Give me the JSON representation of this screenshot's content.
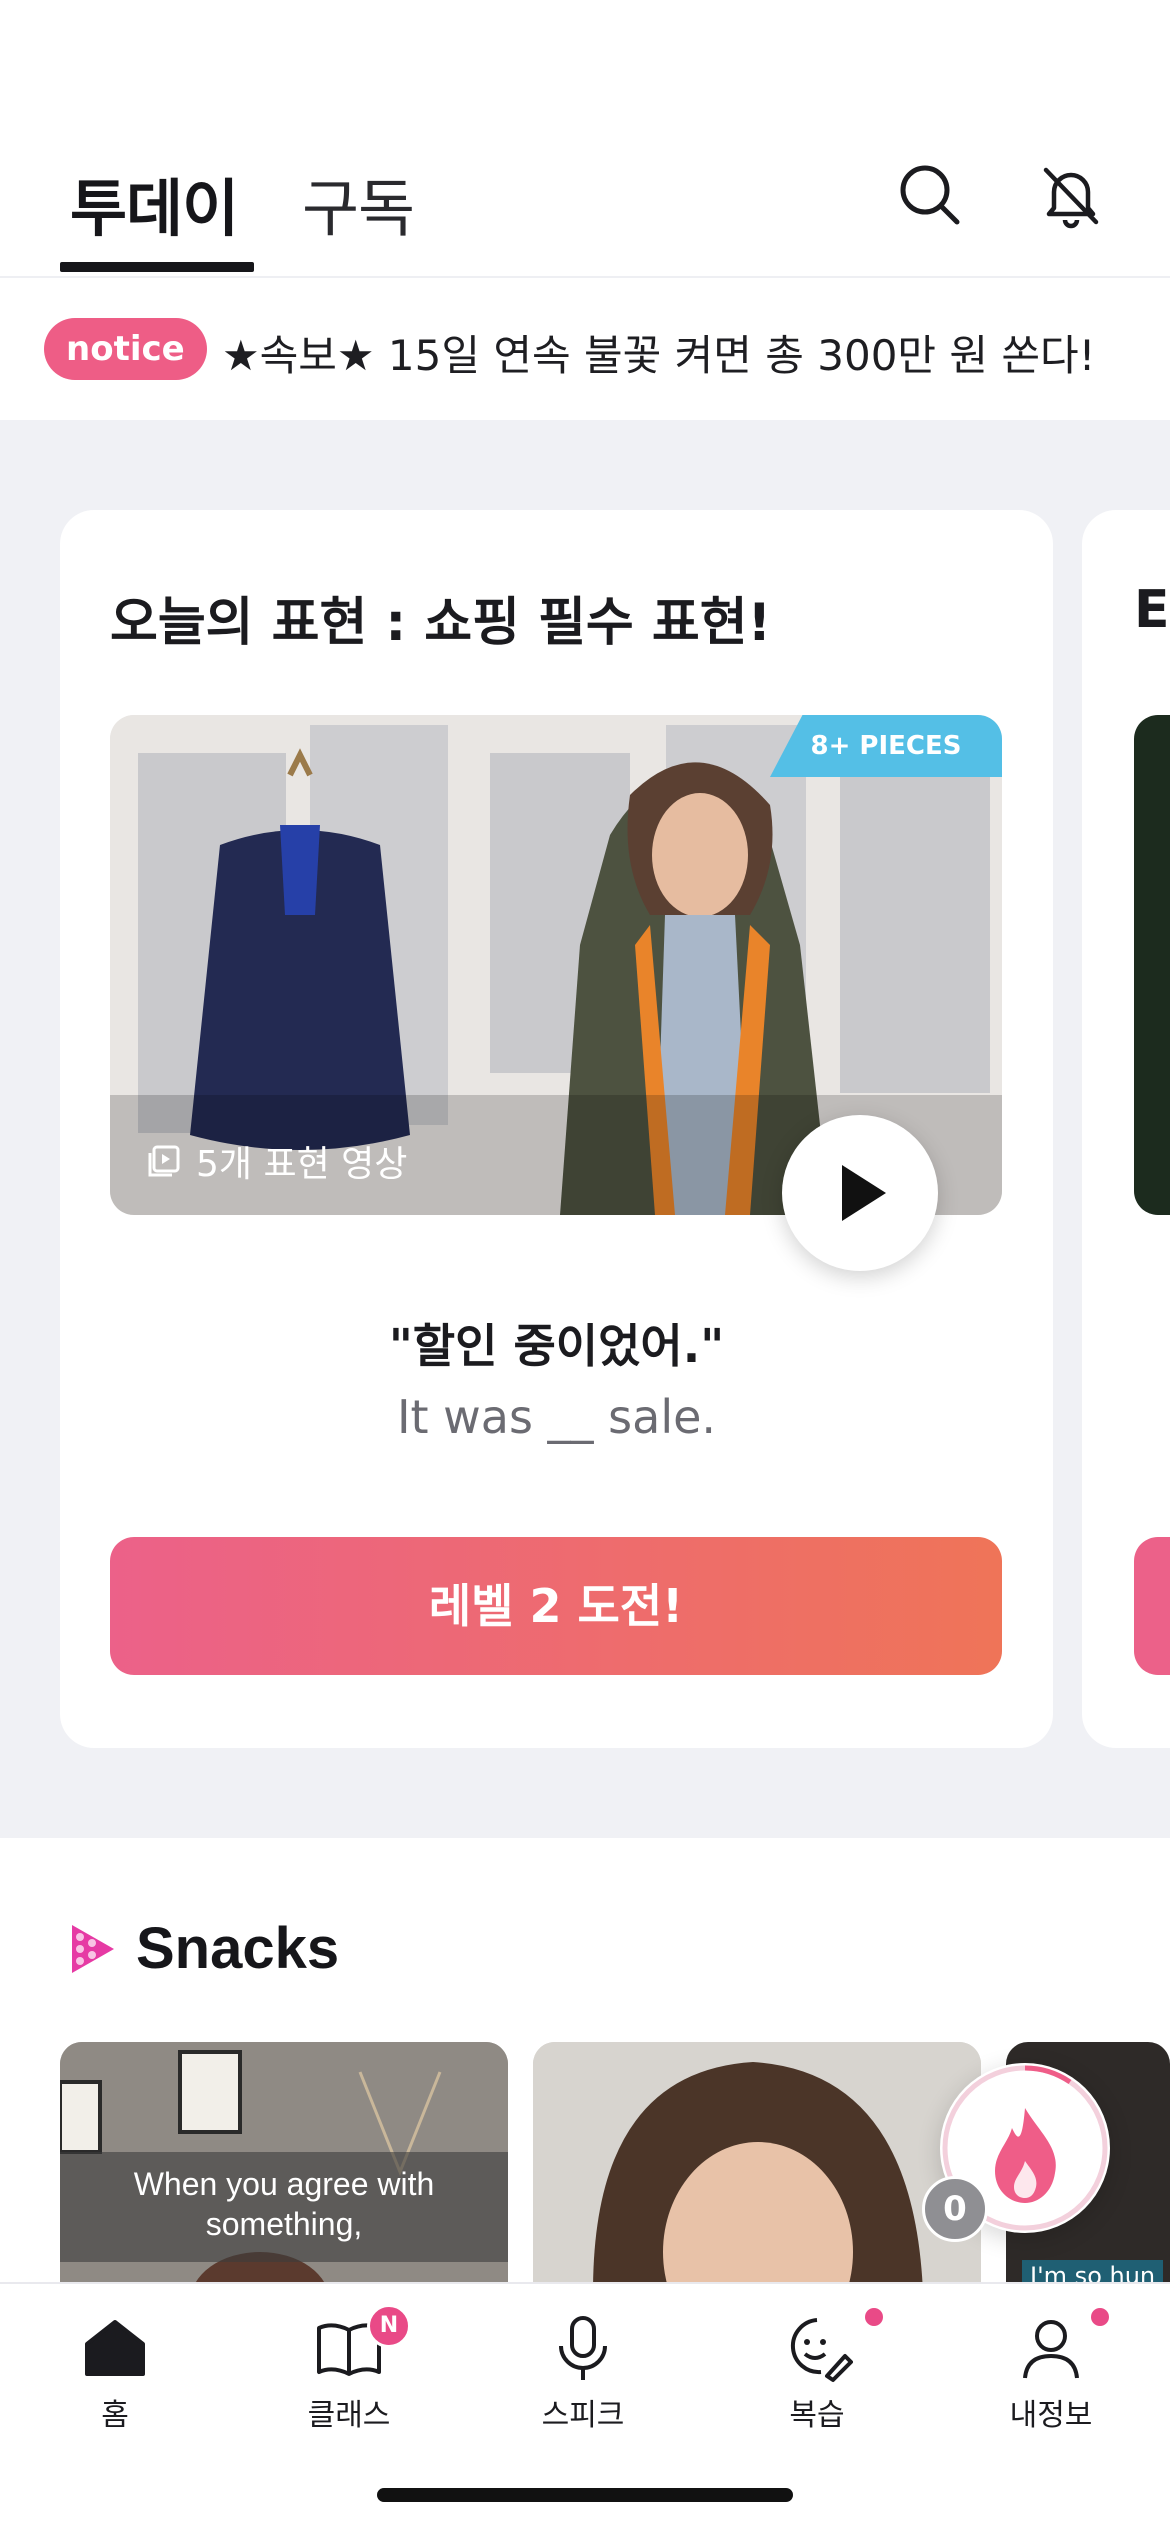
{
  "header": {
    "tabs": [
      {
        "label": "투데이",
        "active": true
      },
      {
        "label": "구독",
        "active": false
      }
    ],
    "icons": [
      "search-icon",
      "bell-off-icon"
    ]
  },
  "notice": {
    "badge": "notice",
    "text": "★속보★ 15일 연속 불꽃 켜면 총 300만 원 쏜다!"
  },
  "expression_card": {
    "title": "오늘의 표현 : 쇼핑 필수 표현!",
    "pieces_badge": "8+ PIECES",
    "video_label": "5개 표현 영상",
    "quote": "\"할인 중이었어.\"",
    "sentence": "It was __ sale.",
    "cta": "레벨 2 도전!"
  },
  "next_card": {
    "title_partial": "E"
  },
  "snacks": {
    "title": "Snacks",
    "items": [
      {
        "caption": "When you agree with something,"
      },
      {
        "caption": ""
      },
      {
        "caption": "I'm so hun"
      }
    ]
  },
  "streak": {
    "count": "0",
    "accent": "#ef5d88"
  },
  "nav": {
    "items": [
      {
        "label": "홈",
        "icon": "home-icon"
      },
      {
        "label": "클래스",
        "icon": "book-icon",
        "badge": "N"
      },
      {
        "label": "스피크",
        "icon": "mic-icon"
      },
      {
        "label": "복습",
        "icon": "review-face-icon"
      },
      {
        "label": "내정보",
        "icon": "profile-icon"
      }
    ]
  },
  "colors": {
    "brand_pink": "#ec6189",
    "brand_orange": "#ef7458",
    "badge_pink": "#e94a87"
  }
}
